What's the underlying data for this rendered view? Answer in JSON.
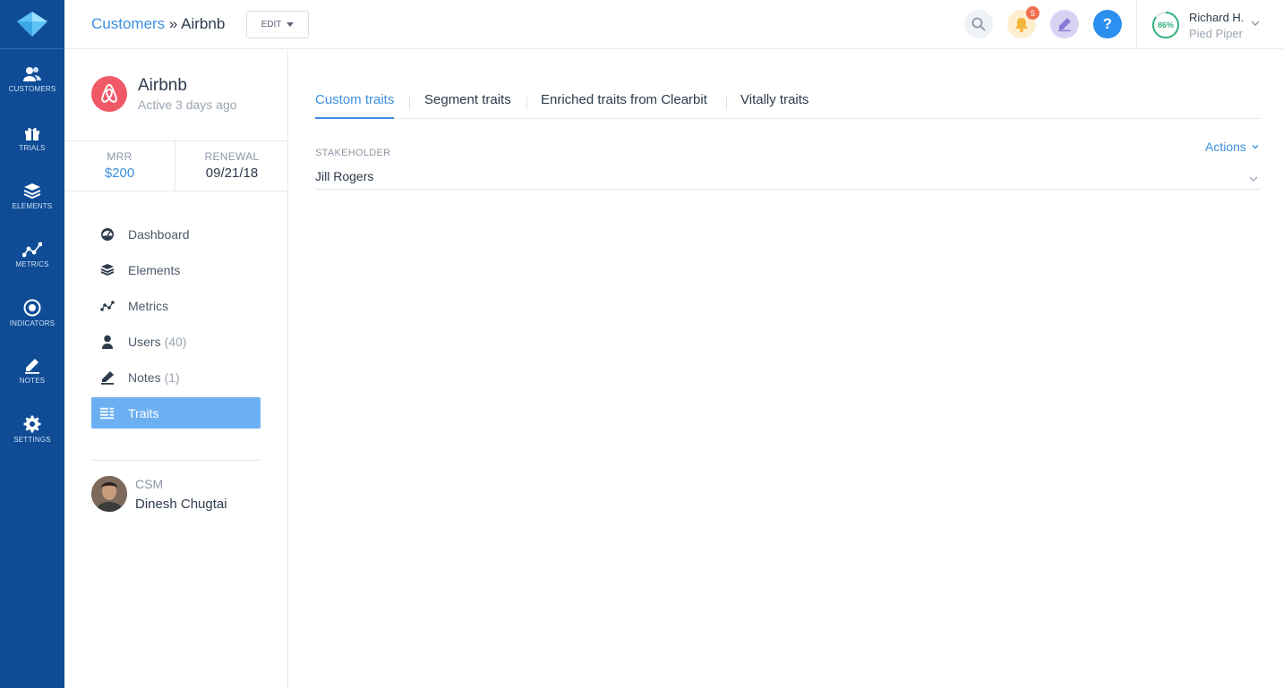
{
  "rail": {
    "items": [
      {
        "label": "CUSTOMERS",
        "icon": "users-icon"
      },
      {
        "label": "TRIALS",
        "icon": "gift-icon"
      },
      {
        "label": "ELEMENTS",
        "icon": "layers-icon"
      },
      {
        "label": "METRICS",
        "icon": "metrics-icon"
      },
      {
        "label": "INDICATORS",
        "icon": "target-icon"
      },
      {
        "label": "NOTES",
        "icon": "pencil-icon"
      },
      {
        "label": "SETTINGS",
        "icon": "gear-icon"
      }
    ]
  },
  "header": {
    "breadcrumb_link": "Customers",
    "breadcrumb_sep": " » ",
    "breadcrumb_current": "Airbnb",
    "edit_label": "EDIT",
    "notification_count": "5",
    "help_label": "?",
    "health_score": "86%",
    "user_name": "Richard H.",
    "user_org": "Pied Piper"
  },
  "customer": {
    "name": "Airbnb",
    "active": "Active 3 days ago",
    "mrr_label": "MRR",
    "mrr_value": "$200",
    "renewal_label": "RENEWAL",
    "renewal_value": "09/21/18"
  },
  "menu": [
    {
      "label": "Dashboard",
      "count": "",
      "icon": "dashboard-icon"
    },
    {
      "label": "Elements",
      "count": "",
      "icon": "layers-icon"
    },
    {
      "label": "Metrics",
      "count": "",
      "icon": "metrics-icon"
    },
    {
      "label": "Users",
      "count": "(40)",
      "icon": "user-icon"
    },
    {
      "label": "Notes",
      "count": "(1)",
      "icon": "pencil-icon"
    },
    {
      "label": "Traits",
      "count": "",
      "icon": "traits-icon"
    }
  ],
  "csm": {
    "role": "CSM",
    "name": "Dinesh Chugtai"
  },
  "tabs": [
    {
      "label": "Custom traits"
    },
    {
      "label": "Segment traits"
    },
    {
      "label": "Enriched traits from Clearbit"
    },
    {
      "label": "Vitally traits"
    }
  ],
  "traits": {
    "field_label": "STAKEHOLDER",
    "field_value": "Jill Rogers",
    "actions_label": "Actions"
  },
  "colors": {
    "rail": "#0f4c95",
    "accent": "#3b8fe0",
    "active_menu": "#6cb0f2",
    "badge": "#f26c4f",
    "brand": "#f05a66"
  }
}
